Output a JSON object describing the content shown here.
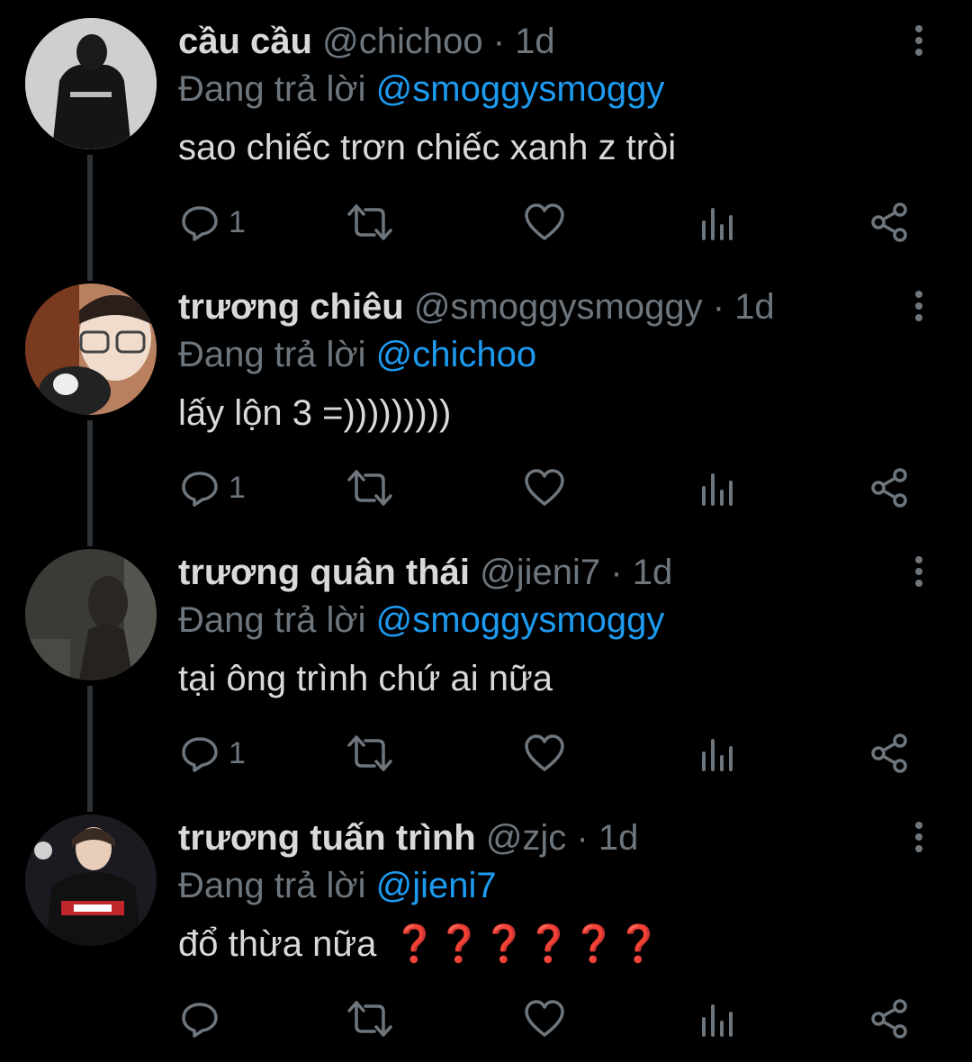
{
  "tweets": [
    {
      "name": "cầu cầu",
      "handle": "@chichoo",
      "sep": "·",
      "time": "1d",
      "replying_prefix": "Đang trả lời",
      "replying_to": "@smoggysmoggy",
      "text": "sao chiếc trơn chiếc xanh z tròi",
      "reply_count": "1"
    },
    {
      "name": "trương chiêu",
      "handle": "@smoggysmoggy",
      "sep": "·",
      "time": "1d",
      "replying_prefix": "Đang trả lời",
      "replying_to": "@chichoo",
      "text": "lấy lộn 3 =)))))))))",
      "reply_count": "1"
    },
    {
      "name": "trương quân thái",
      "handle": "@jieni7",
      "sep": "·",
      "time": "1d",
      "replying_prefix": "Đang trả lời",
      "replying_to": "@smoggysmoggy",
      "text": "tại ông trình chứ ai nữa",
      "reply_count": "1"
    },
    {
      "name": "trương tuấn trình",
      "handle": "@zjc",
      "sep": "·",
      "time": "1d",
      "replying_prefix": "Đang trả lời",
      "replying_to": "@jieni7",
      "text": "đổ thừa nữa",
      "emoji": "❓❓❓❓❓❓",
      "reply_count": ""
    }
  ],
  "icons": {
    "reply": "reply-icon",
    "retweet": "retweet-icon",
    "like": "heart-icon",
    "analytics": "analytics-icon",
    "share": "share-icon",
    "more": "more-vertical-icon"
  },
  "colors": {
    "background": "#000000",
    "text": "#d9d9d9",
    "muted": "#6e767d",
    "mention": "#1d9bf0",
    "emoji_red": "#d61a1a"
  }
}
